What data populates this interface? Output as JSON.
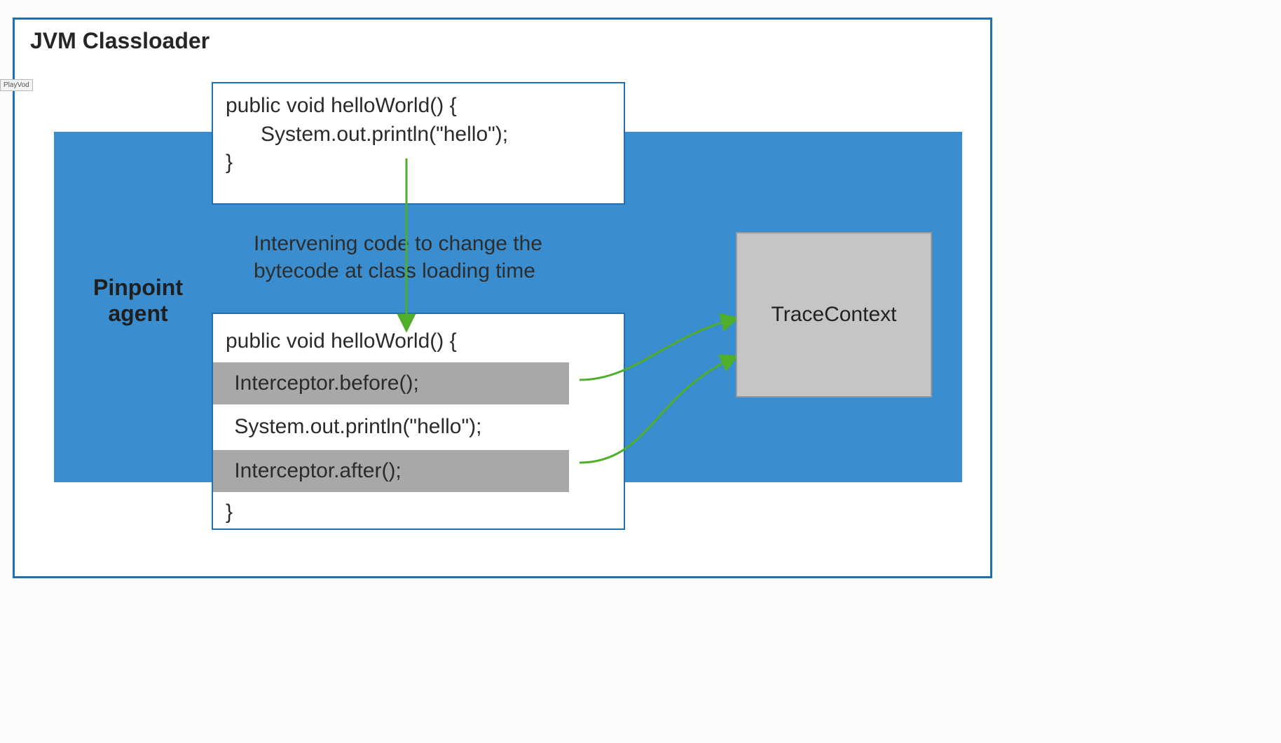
{
  "outer": {
    "title": "JVM Classloader"
  },
  "agent": {
    "label": "Pinpoint\nagent"
  },
  "top_code": {
    "line1": "public void helloWorld() {",
    "line2": "      System.out.println(\"hello\");",
    "line3": "}"
  },
  "intervening": "Intervening code to change the bytecode at class loading time",
  "bottom_code": {
    "line1": "public void helloWorld() {",
    "before": " Interceptor.before();",
    "mid": " System.out.println(\"hello\");",
    "after": " Interceptor.after();",
    "close": "}"
  },
  "trace": {
    "label": "TraceContext"
  },
  "tag": {
    "text": "PlayVod"
  }
}
